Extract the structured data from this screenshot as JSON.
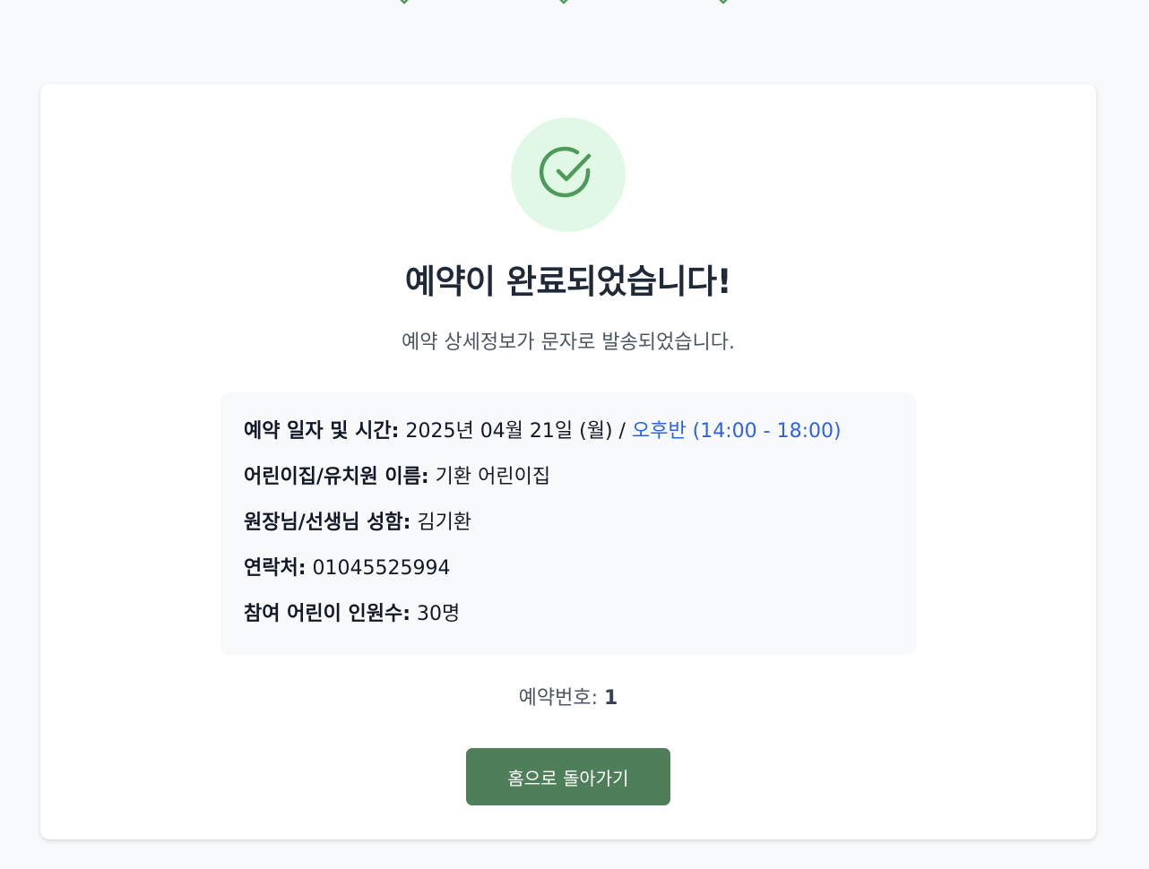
{
  "colors": {
    "page_background": "#f7f9fb",
    "card_background": "#ffffff",
    "success_green": "#4e9b59",
    "success_circle_background": "#e2f8e7",
    "details_background": "#f8f9fb",
    "time_slot_blue": "#2f63d9",
    "button_green": "#4e7f59"
  },
  "step_indicators": [
    {
      "icon": "check-icon",
      "state": "completed"
    },
    {
      "icon": "check-icon",
      "state": "completed"
    },
    {
      "icon": "check-icon",
      "state": "completed"
    }
  ],
  "confirmation": {
    "icon": "check-circle-icon",
    "title": "예약이 완료되었습니다!",
    "subtitle": "예약 상세정보가 문자로 발송되었습니다."
  },
  "details": [
    {
      "label": "예약 일자 및 시간:",
      "value": "2025년 04월 21일 (월) /",
      "highlight": "오후반 (14:00 - 18:00)"
    },
    {
      "label": "어린이집/유치원 이름:",
      "value": "기환 어린이집"
    },
    {
      "label": "원장님/선생님 성함:",
      "value": "김기환"
    },
    {
      "label": "연락처:",
      "value": "01045525994"
    },
    {
      "label": "참여 어린이 인원수:",
      "value": "30명"
    }
  ],
  "booking": {
    "label": "예약번호:",
    "number": "1"
  },
  "home_button_label": "홈으로 돌아가기"
}
